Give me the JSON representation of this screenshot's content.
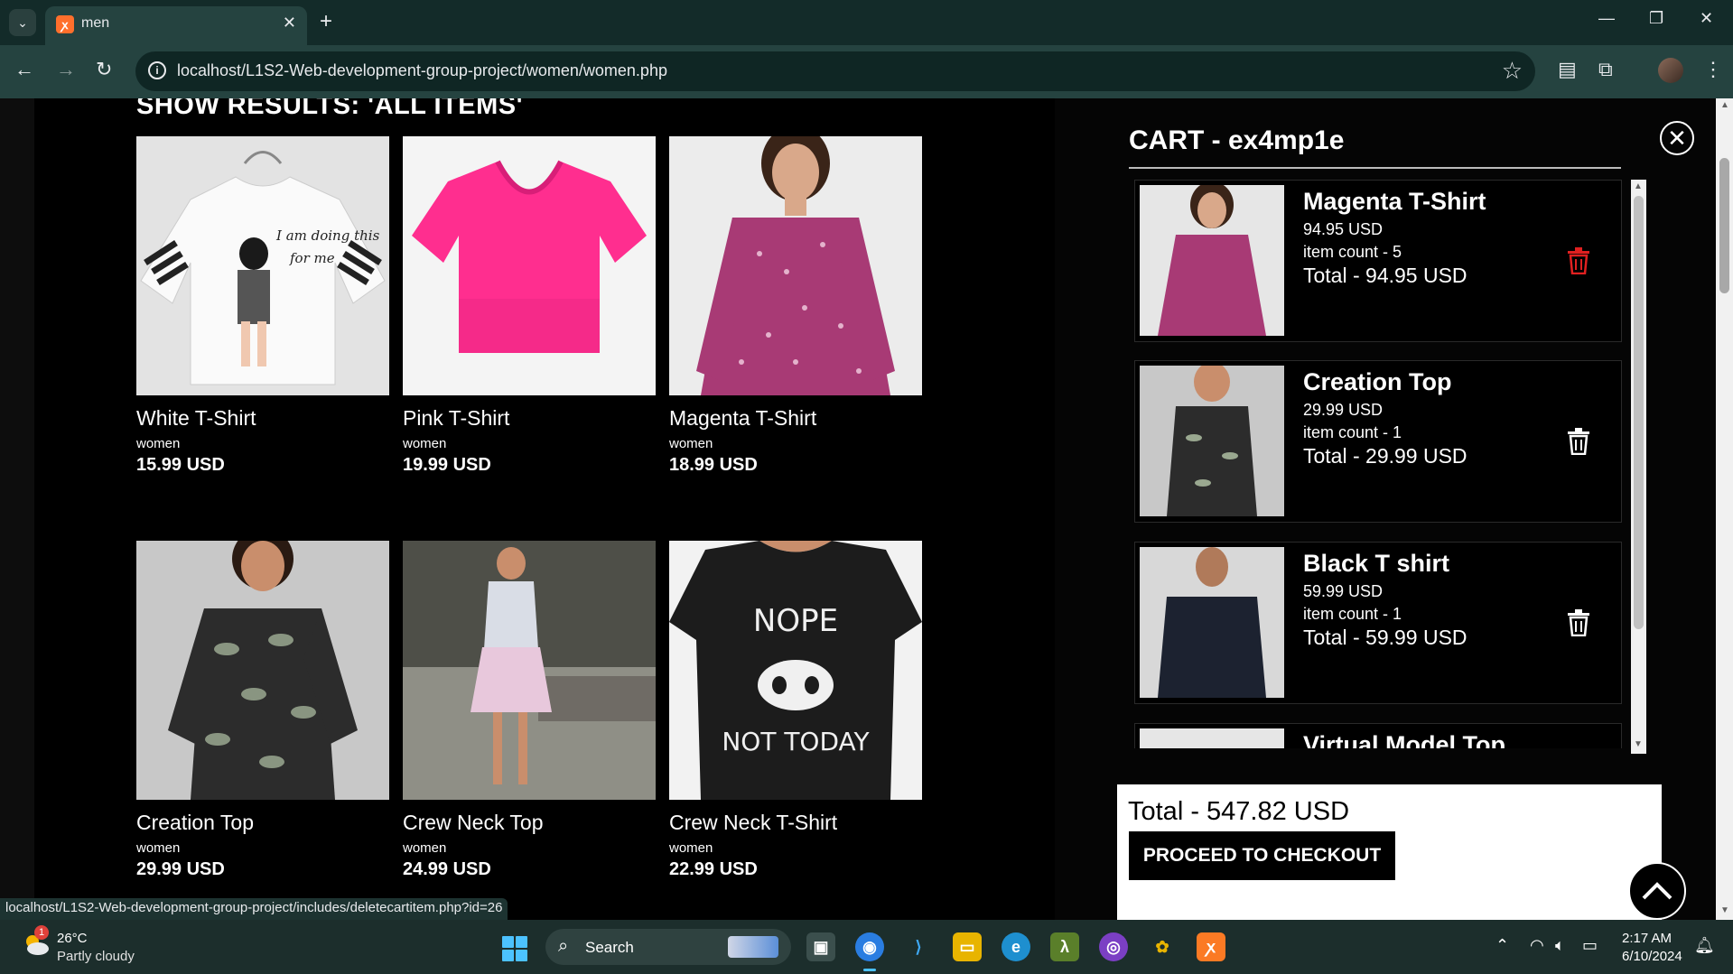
{
  "browser": {
    "tab_title": "men",
    "url": "localhost/L1S2-Web-development-group-project/women/women.php",
    "status_url": "localhost/L1S2-Web-development-group-project/includes/deletecartitem.php?id=26"
  },
  "main": {
    "heading": "SHOW RESULTS: 'ALL ITEMS'",
    "products": [
      {
        "name": "White T-Shirt",
        "category": "women",
        "price": "15.99 USD"
      },
      {
        "name": "Pink T-Shirt",
        "category": "women",
        "price": "19.99 USD"
      },
      {
        "name": "Magenta T-Shirt",
        "category": "women",
        "price": "18.99 USD"
      },
      {
        "name": "Creation Top",
        "category": "women",
        "price": "29.99 USD"
      },
      {
        "name": "Crew Neck Top",
        "category": "women",
        "price": "24.99 USD"
      },
      {
        "name": "Crew Neck T-Shirt",
        "category": "women",
        "price": "22.99 USD"
      }
    ],
    "tshirt_print_1": "NOPE",
    "tshirt_print_2": "NOT TODAY",
    "tshirt_script": "I am doing this for me"
  },
  "cart": {
    "title": "CART - ex4mp1e",
    "items": [
      {
        "name": "Magenta T-Shirt",
        "unit_price": "94.95 USD",
        "count": "item count - 5",
        "total": "Total - 94.95 USD",
        "trash_color": "#e02020"
      },
      {
        "name": "Creation Top",
        "unit_price": "29.99 USD",
        "count": "item count - 1",
        "total": "Total - 29.99 USD",
        "trash_color": "#ffffff"
      },
      {
        "name": "Black T shirt",
        "unit_price": "59.99 USD",
        "count": "item count - 1",
        "total": "Total - 59.99 USD",
        "trash_color": "#ffffff"
      },
      {
        "name": "Virtual Model Top"
      }
    ],
    "grand_total": "Total - 547.82 USD",
    "checkout_label": "PROCEED TO CHECKOUT"
  },
  "taskbar": {
    "weather_temp": "26°C",
    "weather_desc": "Partly cloudy",
    "weather_badge": "1",
    "search_label": "Search",
    "time": "2:17 AM",
    "date": "6/10/2024"
  }
}
